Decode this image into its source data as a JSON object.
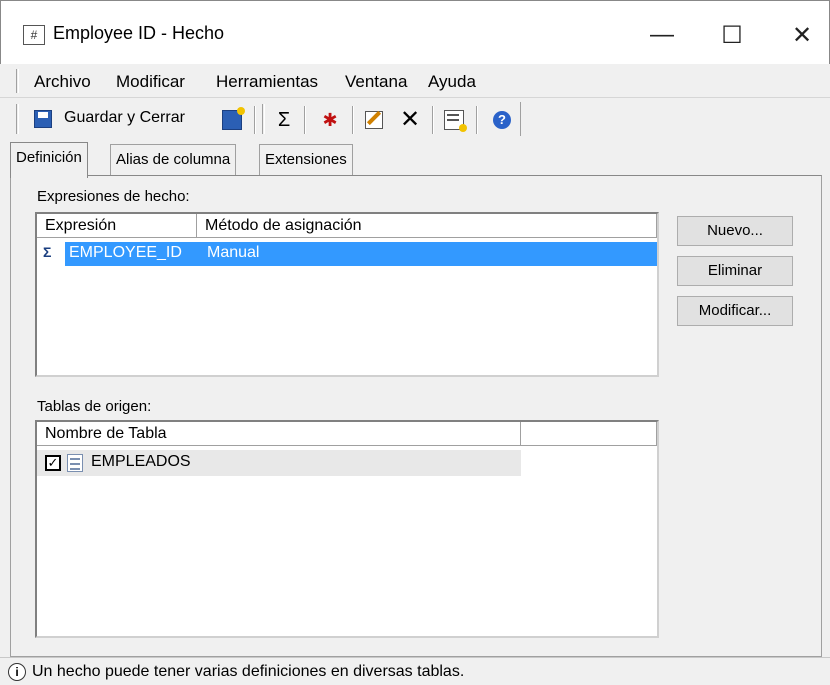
{
  "window": {
    "title": "Employee ID - Hecho",
    "app_icon_text": "#",
    "minimize_glyph": "—",
    "maximize_glyph": "☐",
    "close_glyph": "✕"
  },
  "menu": {
    "items": [
      "Archivo",
      "Modificar",
      "Herramientas",
      "Ventana",
      "Ayuda"
    ]
  },
  "toolbar": {
    "save_close_label": "Guardar y Cerrar",
    "icons": [
      "save-icon",
      "save-as-icon",
      "expression-icon",
      "insert-function-icon",
      "edit-icon",
      "delete-icon",
      "properties-icon",
      "help-icon"
    ]
  },
  "tabs": [
    {
      "label": "Definición",
      "active": true
    },
    {
      "label": "Alias de columna",
      "active": false
    },
    {
      "label": "Extensiones",
      "active": false
    }
  ],
  "expressions": {
    "section_label": "Expresiones de hecho:",
    "columns": [
      "Expresión",
      "Método de asignación"
    ],
    "rows": [
      {
        "expression": "EMPLOYEE_ID",
        "method": "Manual",
        "selected": true
      }
    ]
  },
  "buttons": {
    "new": "Nuevo...",
    "delete": "Eliminar",
    "modify": "Modificar..."
  },
  "source_tables": {
    "section_label": "Tablas de origen:",
    "columns": [
      "Nombre de Tabla",
      ""
    ],
    "rows": [
      {
        "name": "EMPLEADOS",
        "checked": true
      }
    ]
  },
  "status": {
    "text": "Un hecho puede tener varias definiciones en diversas tablas."
  },
  "colors": {
    "selection": "#3399ff",
    "window_bg": "#f0f0f0"
  }
}
